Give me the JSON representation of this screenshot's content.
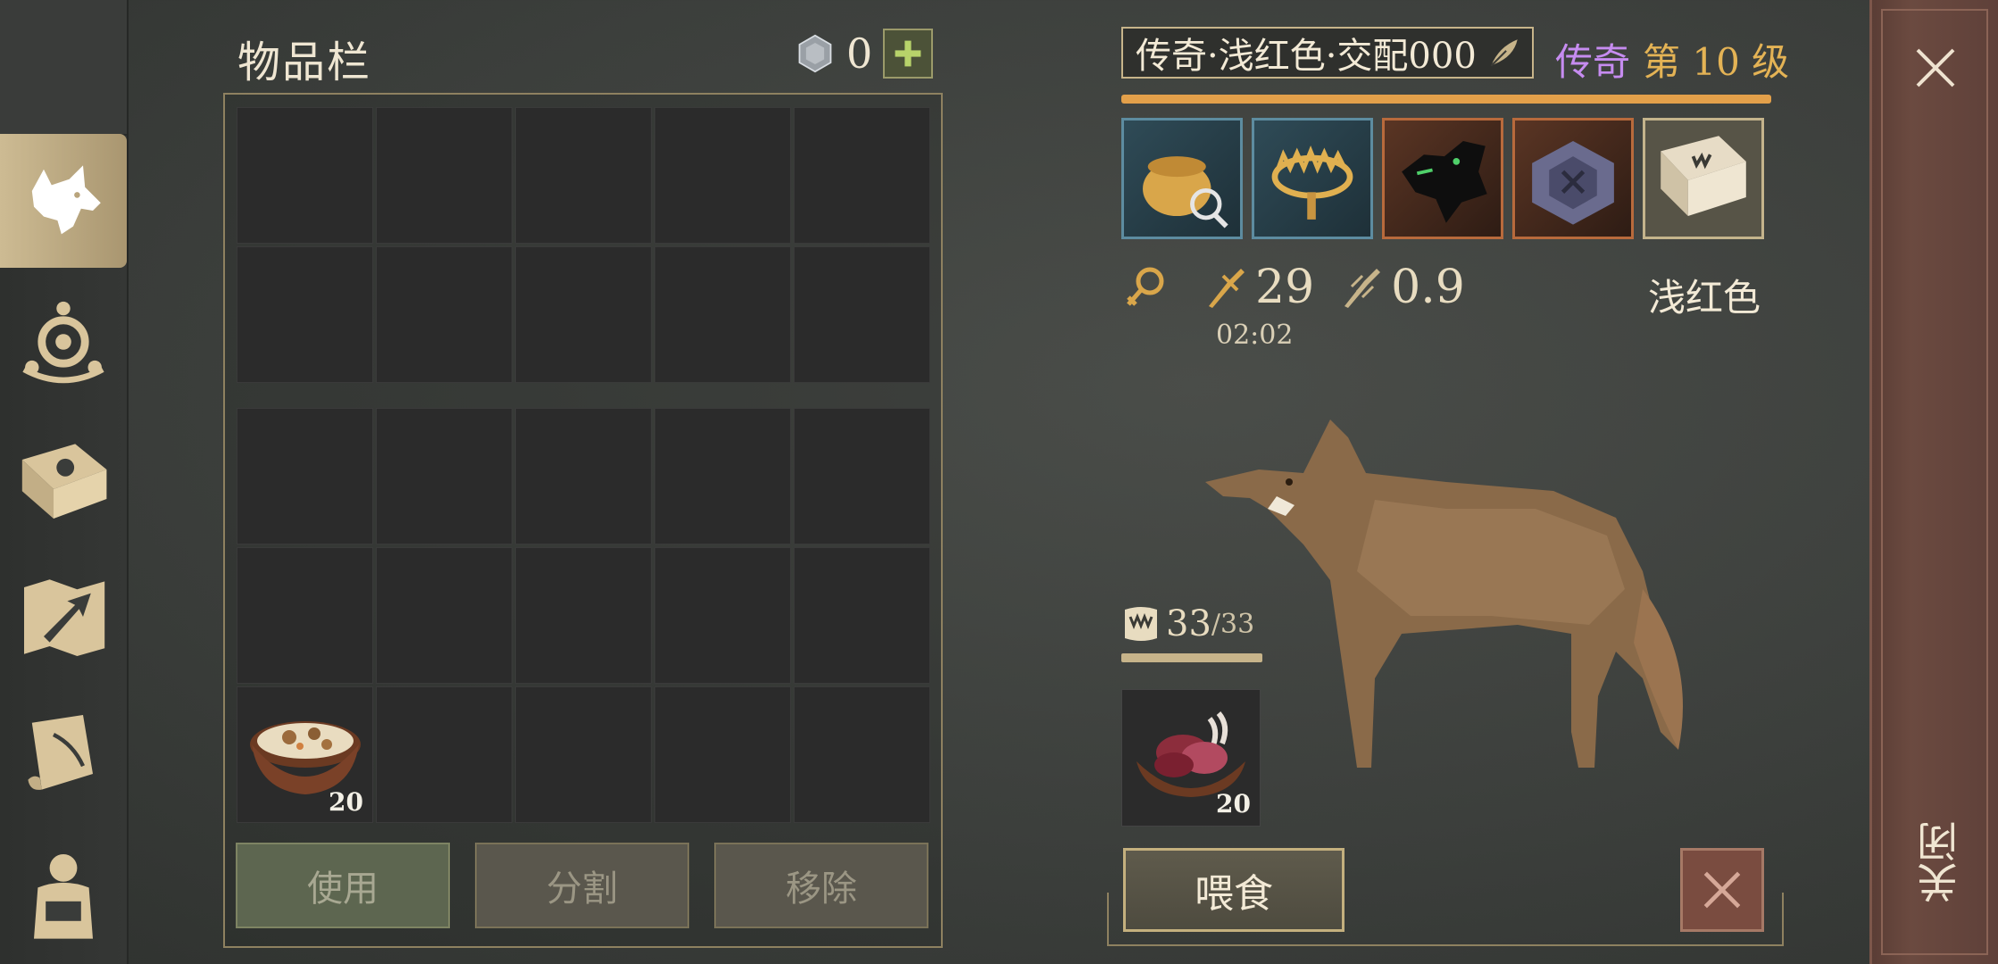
{
  "nav": {
    "items": [
      {
        "icon": "wolf-head-icon",
        "active": true
      },
      {
        "icon": "tribe-emblem-icon",
        "active": false
      },
      {
        "icon": "sun-book-icon",
        "active": false
      },
      {
        "icon": "map-arrow-icon",
        "active": false
      },
      {
        "icon": "quill-scroll-icon",
        "active": false
      },
      {
        "icon": "character-backpack-icon",
        "active": false
      }
    ]
  },
  "inventory": {
    "title": "物品栏",
    "currency_count": "0",
    "stew_qty": "20",
    "buttons": {
      "use": "使用",
      "split": "分割",
      "remove": "移除"
    }
  },
  "pet": {
    "name": "传奇·浅红色·交配000",
    "rarity": "传奇",
    "level": "第 10 级",
    "attack": "29",
    "cooldown": "0.9",
    "timer": "02:02",
    "color_label": "浅红色",
    "hunger_current": "33",
    "hunger_max": "/33",
    "hunger_fraction": 1.0,
    "food_qty": "20",
    "feed_label": "喂食"
  },
  "close": {
    "label": "关闭"
  },
  "colors": {
    "rarity": "#c68cf0",
    "level": "#e4b355",
    "accent_bar": "#e3a04a"
  }
}
